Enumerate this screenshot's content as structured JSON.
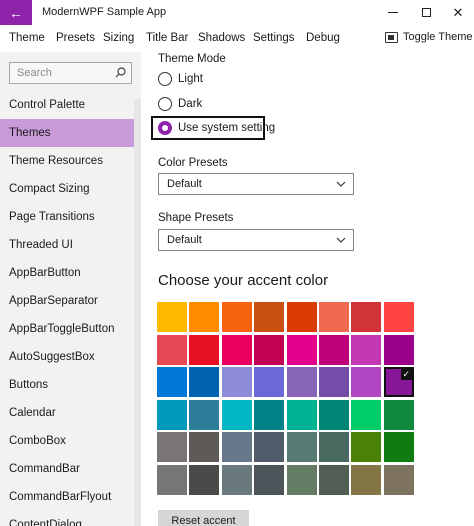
{
  "window": {
    "title": "ModernWPF Sample App"
  },
  "menu": [
    "Theme",
    "Presets",
    "Sizing",
    "Title Bar",
    "Shadows",
    "Settings",
    "Debug"
  ],
  "toggle_theme_label": "Toggle Theme",
  "search": {
    "placeholder": "Search"
  },
  "nav": {
    "selected_index": 1,
    "items": [
      "Control Palette",
      "Themes",
      "Theme Resources",
      "Compact Sizing",
      "Page Transitions",
      "Threaded UI",
      "AppBarButton",
      "AppBarSeparator",
      "AppBarToggleButton",
      "AutoSuggestBox",
      "Buttons",
      "Calendar",
      "ComboBox",
      "CommandBar",
      "CommandBarFlyout",
      "ContentDialog"
    ]
  },
  "theme_mode": {
    "label": "Theme Mode",
    "options": [
      "Light",
      "Dark",
      "Use system setting"
    ],
    "selected_index": 2
  },
  "color_presets": {
    "label": "Color Presets",
    "value": "Default"
  },
  "shape_presets": {
    "label": "Shape Presets",
    "value": "Default"
  },
  "accent": {
    "heading": "Choose your accent color",
    "selected_color": "#881798",
    "colors": [
      [
        "#FFB900",
        "#FF8C00",
        "#F7630C",
        "#CA5010",
        "#DA3B01",
        "#EF6950",
        "#D13438",
        "#FF4343"
      ],
      [
        "#E74856",
        "#E81123",
        "#EA005E",
        "#C30052",
        "#E3008C",
        "#BF0077",
        "#C239B3",
        "#9A0089"
      ],
      [
        "#0078D7",
        "#0063B1",
        "#8E8CD8",
        "#6B69D6",
        "#8764B8",
        "#744DA9",
        "#B146C2",
        "#881798"
      ],
      [
        "#0099BC",
        "#2D7D9A",
        "#00B7C3",
        "#038387",
        "#00B294",
        "#018574",
        "#00CC6A",
        "#10893E"
      ],
      [
        "#7A7574",
        "#5D5A58",
        "#68768A",
        "#515C6B",
        "#567C73",
        "#486860",
        "#498205",
        "#107C10"
      ],
      [
        "#767676",
        "#4C4A48",
        "#69797E",
        "#4A5459",
        "#647C64",
        "#525E54",
        "#847545",
        "#7E735F"
      ]
    ],
    "reset_label": "Reset accent color"
  },
  "theme_colors": {
    "accent": "#8e24aa",
    "selection": "#c89ad8"
  }
}
